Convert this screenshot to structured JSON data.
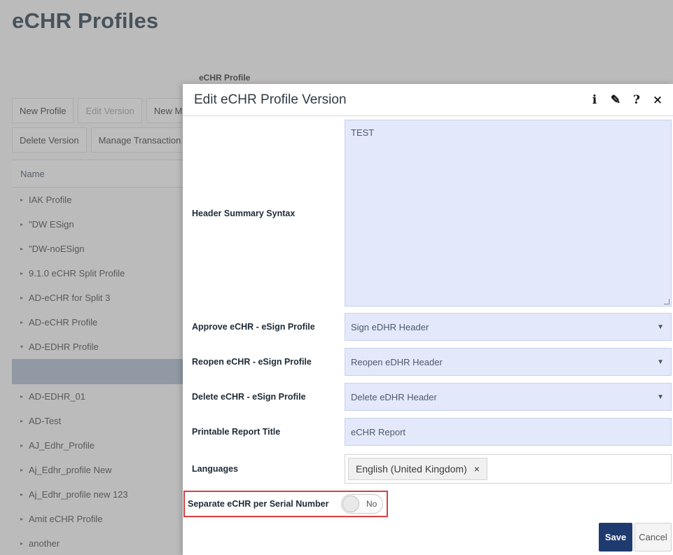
{
  "page": {
    "title": "eCHR Profiles",
    "breadcrumb_label": "eCHR Profile",
    "toolbar_row1": [
      "New Profile",
      "Edit Version",
      "New Ma"
    ],
    "toolbar_row2": [
      "Delete Version",
      "Manage Transaction"
    ],
    "list_header": "Name",
    "tree_items": [
      "IAK Profile",
      "\"DW ESign",
      "\"DW-noESign",
      "9.1.0 eCHR Split Profile",
      "AD-eCHR for Split 3",
      "AD-eCHR Profile",
      "AD-EDHR Profile",
      "",
      "AD-EDHR_01",
      "AD-Test",
      "AJ_Edhr_Profile",
      "Aj_Edhr_profile New",
      "Aj_Edhr_profile new 123",
      "Amit eCHR Profile",
      "another"
    ]
  },
  "modal": {
    "title": "Edit eCHR Profile Version",
    "icons": [
      "info-icon",
      "edit-pencil-icon",
      "help-icon",
      "close-icon"
    ],
    "icon_glyphs": {
      "info": "i",
      "edit": "✎",
      "help": "?",
      "close": "×"
    },
    "header_summary": {
      "label": "Header Summary Syntax",
      "value": "TEST"
    },
    "approve": {
      "label": "Approve eCHR - eSign Profile",
      "value": "Sign eDHR Header"
    },
    "reopen": {
      "label": "Reopen eCHR - eSign Profile",
      "value": "Reopen eDHR Header"
    },
    "delete": {
      "label": "Delete eCHR - eSign Profile",
      "value": "Delete eDHR Header"
    },
    "report_title": {
      "label": "Printable Report Title",
      "value": "eCHR Report"
    },
    "languages": {
      "label": "Languages",
      "tags": [
        "English (United Kingdom)"
      ],
      "remove_glyph": "×"
    },
    "separate": {
      "label": "Separate eCHR per Serial Number",
      "state": "No"
    },
    "save_label": "Save",
    "cancel_label": "Cancel"
  },
  "colors": {
    "field_bg": "#e3e9fb",
    "save_bg": "#1f3a6e",
    "highlight_border": "#d94040",
    "selected_row": "#a9b9cc"
  }
}
